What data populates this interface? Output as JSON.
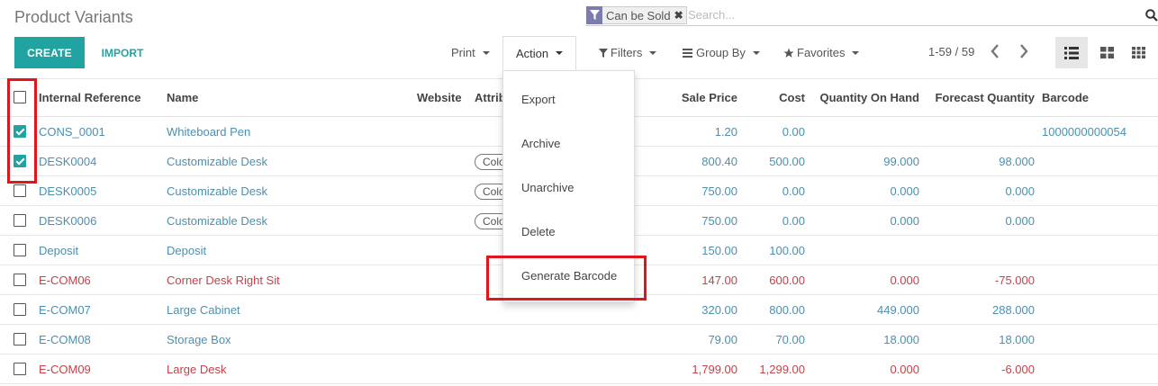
{
  "page": {
    "title": "Product Variants"
  },
  "search": {
    "facet_label": "Can be Sold",
    "placeholder": "Search..."
  },
  "control": {
    "create_label": "CREATE",
    "import_label": "IMPORT",
    "print_label": "Print",
    "action_label": "Action",
    "filters_label": "Filters",
    "groupby_label": "Group By",
    "favorites_label": "Favorites",
    "pager": "1-59 / 59"
  },
  "action_menu": [
    "Export",
    "Archive",
    "Unarchive",
    "Delete",
    "Generate Barcode"
  ],
  "columns": {
    "internal_ref": "Internal Reference",
    "name": "Name",
    "website": "Website",
    "attributes": "Attrib",
    "sale_price": "Sale Price",
    "cost": "Cost",
    "qty": "Quantity On Hand",
    "forecast": "Forecast Quantity",
    "barcode": "Barcode"
  },
  "rows": [
    {
      "ref": "CONS_0001",
      "name": "Whiteboard Pen",
      "tag": "",
      "price": "1.20",
      "cost": "0.00",
      "qty": "",
      "forecast": "",
      "barcode": "1000000000054",
      "checked": true,
      "red": false
    },
    {
      "ref": "DESK0004",
      "name": "Customizable Desk",
      "tag": "Color",
      "price": "800.40",
      "cost": "500.00",
      "qty": "99.000",
      "forecast": "98.000",
      "barcode": "",
      "checked": true,
      "red": false
    },
    {
      "ref": "DESK0005",
      "name": "Customizable Desk",
      "tag": "Color",
      "price": "750.00",
      "cost": "0.00",
      "qty": "0.000",
      "forecast": "0.000",
      "barcode": "",
      "checked": false,
      "red": false
    },
    {
      "ref": "DESK0006",
      "name": "Customizable Desk",
      "tag": "Color",
      "price": "750.00",
      "cost": "0.00",
      "qty": "0.000",
      "forecast": "0.000",
      "barcode": "",
      "checked": false,
      "red": false
    },
    {
      "ref": "Deposit",
      "name": "Deposit",
      "tag": "",
      "price": "150.00",
      "cost": "100.00",
      "qty": "",
      "forecast": "",
      "barcode": "",
      "checked": false,
      "red": false
    },
    {
      "ref": "E-COM06",
      "name": "Corner Desk Right Sit",
      "tag": "",
      "price": "147.00",
      "cost": "600.00",
      "qty": "0.000",
      "forecast": "-75.000",
      "barcode": "",
      "checked": false,
      "red": true
    },
    {
      "ref": "E-COM07",
      "name": "Large Cabinet",
      "tag": "",
      "price": "320.00",
      "cost": "800.00",
      "qty": "449.000",
      "forecast": "288.000",
      "barcode": "",
      "checked": false,
      "red": false
    },
    {
      "ref": "E-COM08",
      "name": "Storage Box",
      "tag": "",
      "price": "79.00",
      "cost": "70.00",
      "qty": "18.000",
      "forecast": "18.000",
      "barcode": "",
      "checked": false,
      "red": false
    },
    {
      "ref": "E-COM09",
      "name": "Large Desk",
      "tag": "",
      "price": "1,799.00",
      "cost": "1,299.00",
      "qty": "0.000",
      "forecast": "-6.000",
      "barcode": "",
      "checked": false,
      "red": true
    }
  ],
  "colors": {
    "accent": "#21a3a1",
    "link": "#4d8fae",
    "danger": "#c3424b",
    "highlight": "#e2151b",
    "facet": "#7c7bad"
  },
  "icons": [
    "filter-icon",
    "close-icon",
    "search-icon",
    "chevron-left-icon",
    "chevron-right-icon",
    "list-view-icon",
    "kanban-view-icon",
    "grid-view-icon",
    "star-icon",
    "bars-icon"
  ]
}
